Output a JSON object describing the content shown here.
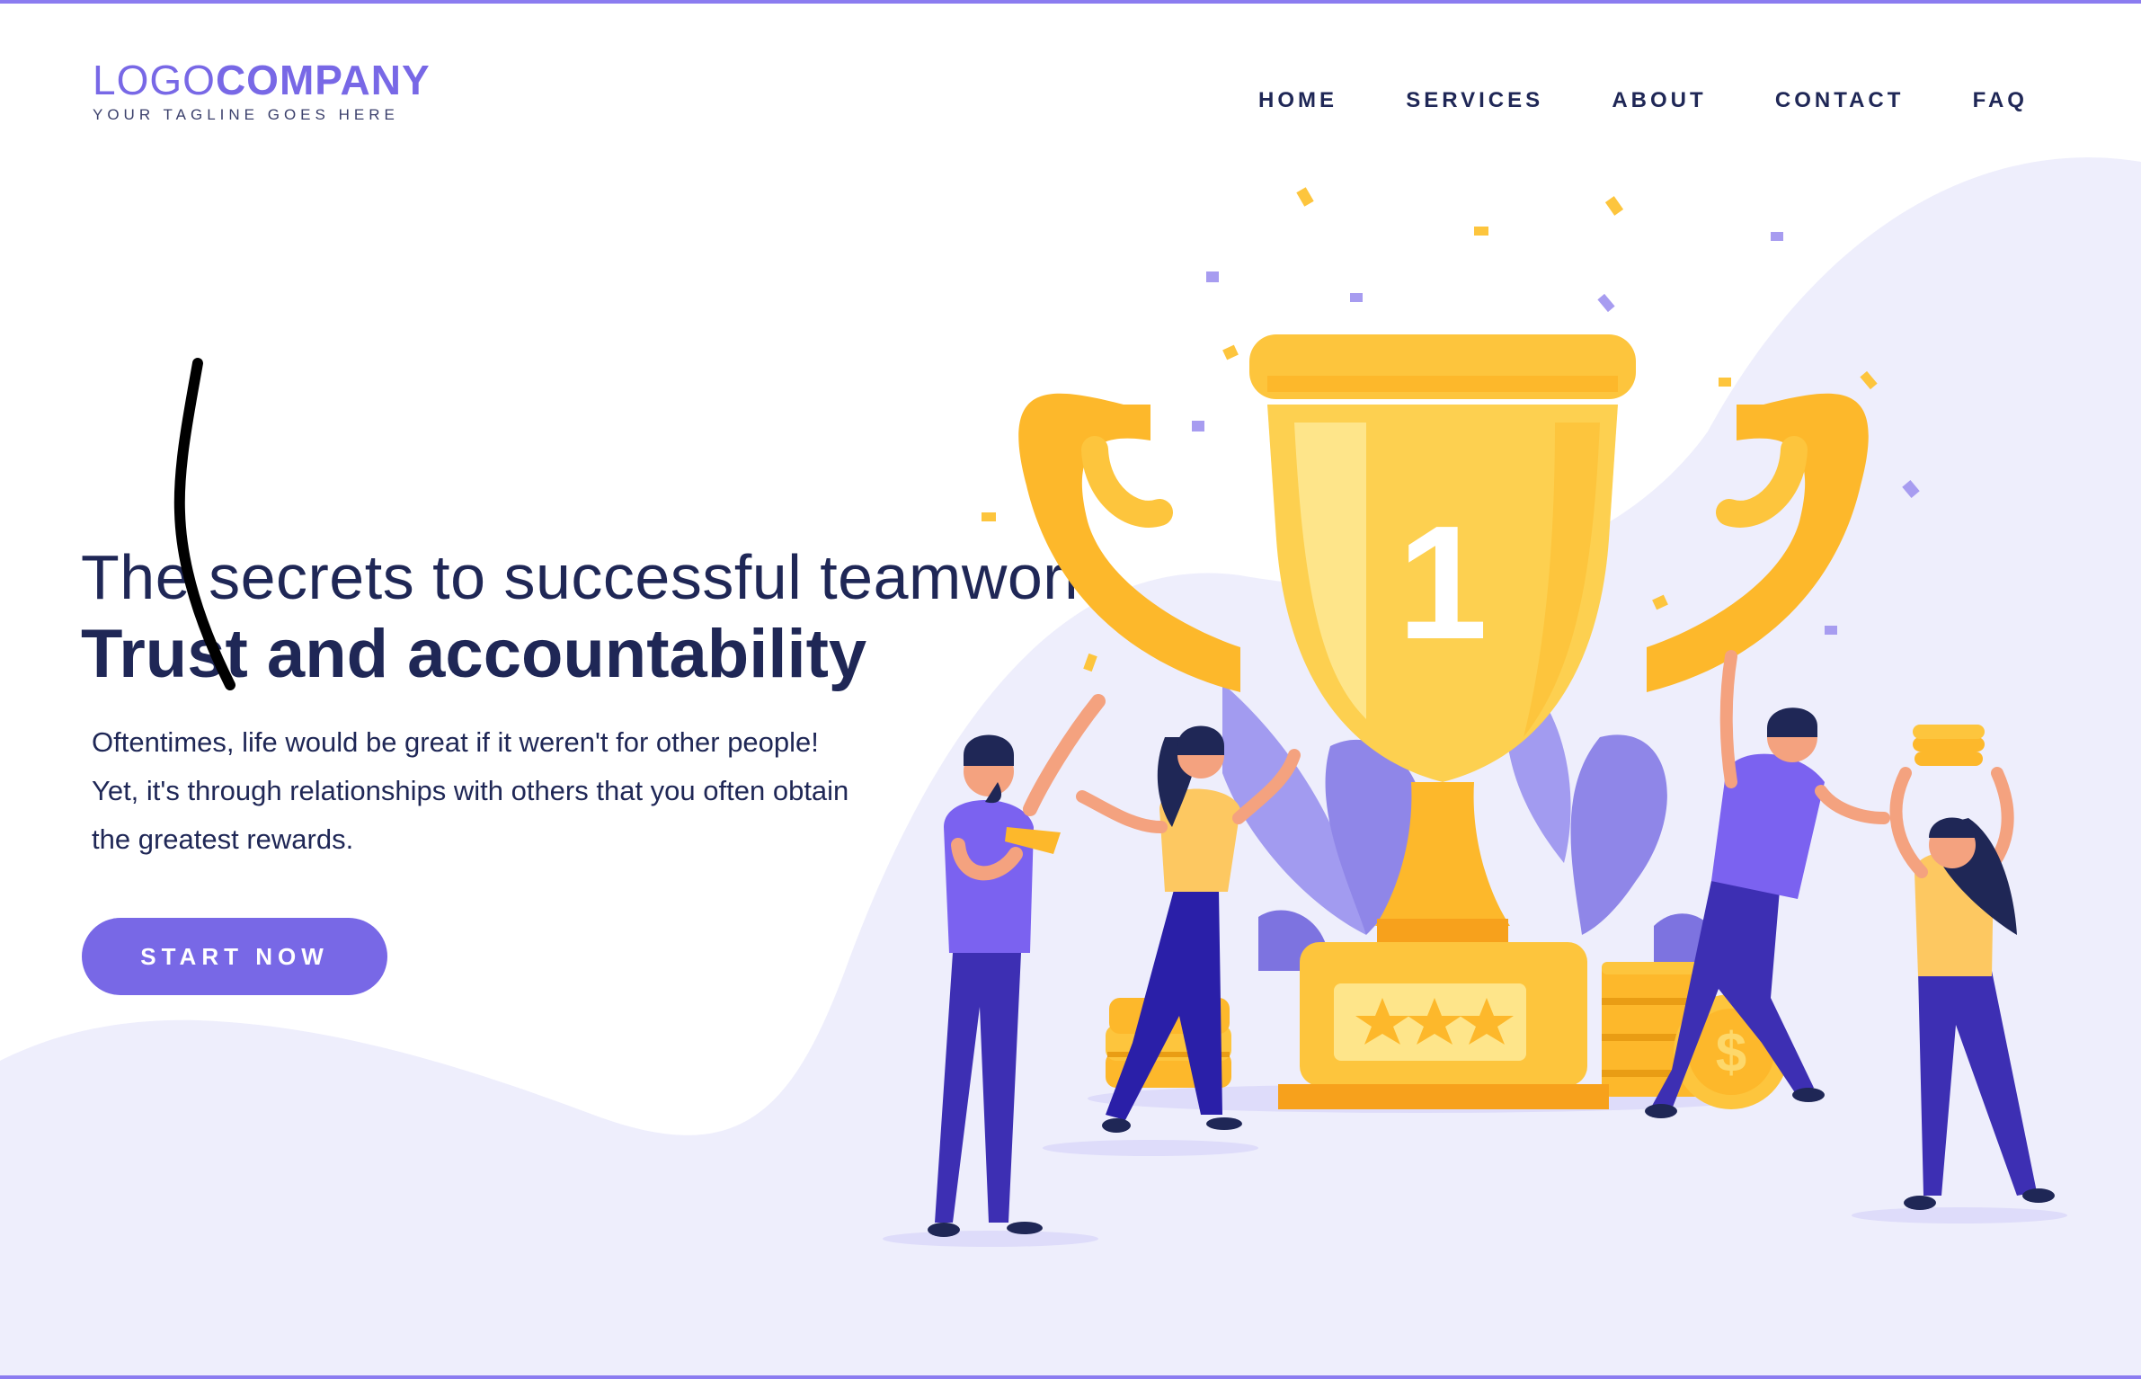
{
  "header": {
    "logo": {
      "part_light": "LOGO",
      "part_bold": "COMPANY",
      "tagline": "YOUR TAGLINE GOES HERE"
    },
    "nav": {
      "home": "HOME",
      "services": "SERVICES",
      "about": "ABOUT",
      "contact": "CONTACT",
      "faq": "FAQ"
    }
  },
  "hero": {
    "heading_light": "The secrets to successful teamwork",
    "heading_bold": "Trust and accountability",
    "description": [
      "Oftentimes, life would be great if it weren't for other people!",
      "Yet, it's through relationships with others that you often obtain",
      "the greatest rewards."
    ],
    "cta_label": "START NOW"
  },
  "illustration": {
    "trophy_rank": "1",
    "stars_count": 3,
    "coin_symbol": "$"
  },
  "colors": {
    "accent": "#7868e6",
    "heading": "#1f2756",
    "wave": "#eeeefc",
    "trophy": "#fdb82b"
  }
}
